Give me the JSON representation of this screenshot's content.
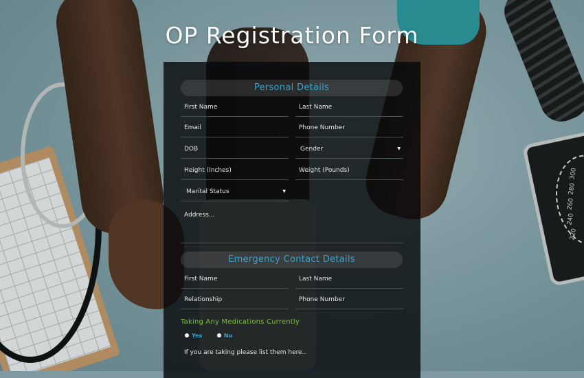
{
  "page": {
    "title": "OP Registration Form",
    "accent_color": "#3aa3c8",
    "highlight_color": "#7cbf3e"
  },
  "personal": {
    "heading": "Personal Details",
    "first_name": {
      "placeholder": "First Name"
    },
    "last_name": {
      "placeholder": "Last Name"
    },
    "email": {
      "placeholder": "Email"
    },
    "phone": {
      "placeholder": "Phone Number"
    },
    "dob": {
      "placeholder": "DOB"
    },
    "gender": {
      "selected": "Gender",
      "icon": "caret-down-icon"
    },
    "height": {
      "placeholder": "Height (Inches)"
    },
    "weight": {
      "placeholder": "Weight (Pounds)"
    },
    "marital_status": {
      "selected": "Marital Status",
      "icon": "caret-down-icon"
    },
    "address": {
      "placeholder": "Address..."
    }
  },
  "emergency": {
    "heading": "Emergency Contact Details",
    "first_name": {
      "placeholder": "First Name"
    },
    "last_name": {
      "placeholder": "Last Name"
    },
    "relationship": {
      "placeholder": "Relationship"
    },
    "phone": {
      "placeholder": "Phone Number"
    }
  },
  "medications": {
    "question": "Taking Any Medications Currently",
    "options": [
      {
        "label": "Yes"
      },
      {
        "label": "No"
      }
    ],
    "list_placeholder": "If you are taking please list them here.."
  },
  "background": {
    "gauge_numbers": [
      "300",
      "280",
      "260",
      "240",
      "220"
    ]
  }
}
